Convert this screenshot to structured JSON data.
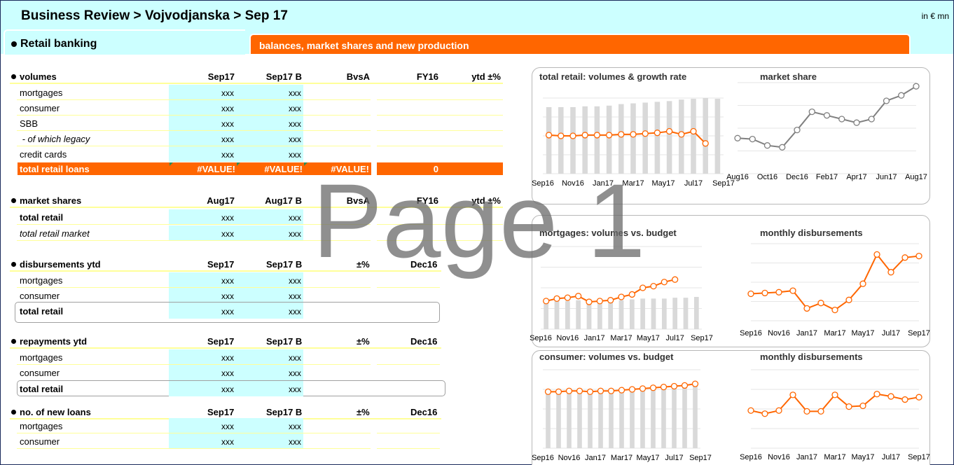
{
  "header": {
    "title": "Business Review > Vojvodjanska > Sep 17",
    "unit": "in € mn",
    "section": "Retail banking",
    "banner": "balances, market shares and new production"
  },
  "watermark": "Page 1",
  "volumes": {
    "title": "volumes",
    "cols": [
      "Sep17",
      "Sep17 B",
      "BvsA",
      "FY16",
      "ytd ±%"
    ],
    "rows": [
      {
        "label": "mortgages",
        "v1": "xxx",
        "v2": "xxx"
      },
      {
        "label": "consumer",
        "v1": "xxx",
        "v2": "xxx"
      },
      {
        "label": "SBB",
        "v1": "xxx",
        "v2": "xxx"
      },
      {
        "label": " - of which legacy",
        "v1": "xxx",
        "v2": "xxx"
      },
      {
        "label": "credit cards",
        "v1": "xxx",
        "v2": "xxx"
      }
    ],
    "total": {
      "label": "total retail loans",
      "v1": "#VALUE!",
      "v2": "#VALUE!",
      "v3": "#VALUE!",
      "v4": "0"
    }
  },
  "market_shares": {
    "title": "market shares",
    "cols": [
      "Aug17",
      "Aug17 B",
      "BvsA",
      "FY16",
      "ytd ±%"
    ],
    "rows": [
      {
        "label": "total retail",
        "v1": "xxx",
        "v2": "xxx"
      },
      {
        "label": "total retail market",
        "v1": "xxx",
        "v2": "xxx"
      }
    ]
  },
  "disbursements": {
    "title": "disbursements ytd",
    "cols": [
      "Sep17",
      "Sep17 B",
      "±%",
      "Dec16"
    ],
    "rows": [
      {
        "label": "mortgages",
        "v1": "xxx",
        "v2": "xxx"
      },
      {
        "label": "consumer",
        "v1": "xxx",
        "v2": "xxx"
      },
      {
        "label": "total retail",
        "v1": "xxx",
        "v2": "xxx"
      }
    ]
  },
  "repayments": {
    "title": "repayments ytd",
    "cols": [
      "Sep17",
      "Sep17 B",
      "±%",
      "Dec16"
    ],
    "rows": [
      {
        "label": "mortgages",
        "v1": "xxx",
        "v2": "xxx"
      },
      {
        "label": "consumer",
        "v1": "xxx",
        "v2": "xxx"
      },
      {
        "label": "total retail",
        "v1": "xxx",
        "v2": "xxx"
      }
    ]
  },
  "new_loans": {
    "title": "no. of new loans",
    "cols": [
      "Sep17",
      "Sep17 B",
      "±%",
      "Dec16"
    ],
    "rows": [
      {
        "label": "mortgages",
        "v1": "xxx",
        "v2": "xxx"
      },
      {
        "label": "consumer",
        "v1": "xxx",
        "v2": "xxx"
      }
    ]
  },
  "colors": {
    "orange": "#ff6600",
    "cyan": "#ccffff",
    "bar": "#d9d9d9",
    "grey_line": "#808080"
  },
  "chart_data": [
    {
      "id": "total-retail",
      "type": "bar",
      "title": "total retail: volumes & growth rate",
      "x_ticks": [
        "Sep16",
        "Nov16",
        "Jan17",
        "Mar17",
        "May17",
        "Jul17",
        "Sep17"
      ],
      "ylim": [
        0,
        100
      ],
      "series": [
        {
          "type": "bar",
          "values": [
            88,
            88,
            88,
            89,
            89,
            90,
            92,
            93,
            94,
            95,
            96,
            98,
            99,
            100,
            99
          ]
        },
        {
          "type": "line",
          "values": [
            51,
            50,
            50,
            51,
            51,
            51,
            52,
            52,
            53,
            54,
            56,
            52,
            56,
            40
          ]
        }
      ]
    },
    {
      "id": "market-share",
      "type": "line",
      "title": "market share",
      "x_ticks": [
        "Aug16",
        "Oct16",
        "Dec16",
        "Feb17",
        "Apr17",
        "Jun17",
        "Aug17"
      ],
      "ylim": [
        0,
        100
      ],
      "series": [
        {
          "type": "line",
          "values": [
            39,
            38,
            31,
            29,
            48,
            68,
            64,
            60,
            56,
            60,
            80,
            86,
            96
          ]
        }
      ]
    },
    {
      "id": "mortgages",
      "type": "bar",
      "title": "mortgages: volumes vs. budget",
      "x_ticks": [
        "Sep16",
        "Nov16",
        "Jan17",
        "Mar17",
        "May17",
        "Jul17",
        "Sep17"
      ],
      "ylim": [
        0,
        100
      ],
      "series": [
        {
          "type": "bar",
          "values": [
            34,
            34,
            34,
            35,
            34,
            35,
            35,
            35,
            36,
            37,
            37,
            37,
            38,
            38,
            39
          ]
        },
        {
          "type": "line",
          "values": [
            34,
            37,
            38,
            40,
            33,
            34,
            35,
            39,
            42,
            50,
            52,
            57,
            60
          ]
        }
      ]
    },
    {
      "id": "monthly-disb-1",
      "type": "line",
      "title": "monthly disbursements",
      "x_ticks": [
        "Sep16",
        "Nov16",
        "Jan17",
        "Mar17",
        "May17",
        "Jul17",
        "Sep17"
      ],
      "ylim": [
        0,
        100
      ],
      "series": [
        {
          "type": "line",
          "values": [
            35,
            36,
            37,
            39,
            16,
            23,
            14,
            27,
            48,
            86,
            63,
            82,
            84
          ]
        }
      ]
    },
    {
      "id": "consumer",
      "type": "bar",
      "title": "consumer: volumes vs. budget",
      "x_ticks": [
        "Sep16",
        "Nov16",
        "Jan17",
        "Mar17",
        "May17",
        "Jul17",
        "Sep17"
      ],
      "ylim": [
        0,
        100
      ],
      "series": [
        {
          "type": "bar",
          "values": [
            72,
            72,
            72,
            73,
            74,
            74,
            75,
            76,
            77,
            78,
            79,
            80,
            81,
            82,
            83
          ]
        },
        {
          "type": "line",
          "values": [
            72,
            72,
            73,
            73,
            72,
            73,
            73,
            74,
            75,
            76,
            77,
            78,
            79,
            80,
            82
          ]
        }
      ]
    },
    {
      "id": "monthly-disb-2",
      "type": "line",
      "title": "monthly disbursements",
      "x_ticks": [
        "Sep16",
        "Nov16",
        "Jan17",
        "Mar17",
        "May17",
        "Jul17",
        "Sep17"
      ],
      "ylim": [
        0,
        100
      ],
      "series": [
        {
          "type": "line",
          "values": [
            48,
            44,
            48,
            68,
            47,
            47,
            68,
            53,
            54,
            69,
            66,
            62,
            65
          ]
        }
      ]
    }
  ]
}
